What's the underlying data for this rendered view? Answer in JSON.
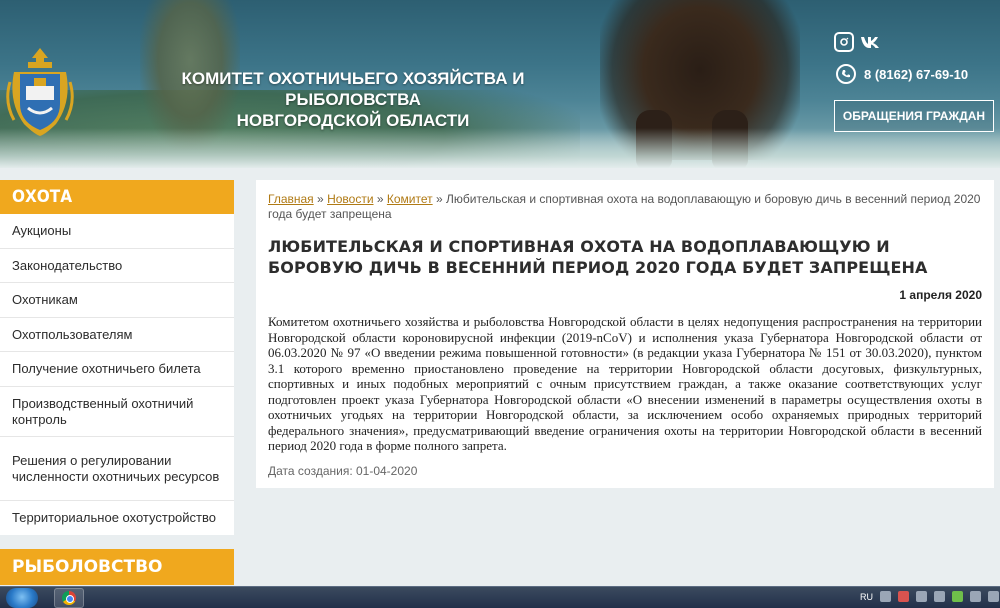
{
  "header": {
    "title_line1": "КОМИТЕТ ОХОТНИЧЬЕГО ХОЗЯЙСТВА И РЫБОЛОВСТВА",
    "title_line2": "НОВГОРОДСКОЙ ОБЛАСТИ",
    "phone": "8 (8162) 67-69-10",
    "appeal_button": "ОБРАЩЕНИЯ ГРАЖДАН",
    "social_icons": [
      "instagram-icon",
      "vk-icon"
    ]
  },
  "sidebar": {
    "section1_title": "ОХОТА",
    "items": [
      {
        "label": "Аукционы"
      },
      {
        "label": "Законодательство"
      },
      {
        "label": "Охотникам"
      },
      {
        "label": "Охотпользователям"
      },
      {
        "label": "Получение охотничьего билета"
      },
      {
        "label": "Производственный охотничий контроль"
      },
      {
        "label": "Решения о регулировании численности охотничьих ресурсов"
      },
      {
        "label": "Территориальное охотустройство"
      }
    ],
    "section2_title": "РЫБОЛОВСТВО"
  },
  "breadcrumb": {
    "home": "Главная",
    "news": "Новости",
    "committee": "Комитет",
    "current": "Любительская и спортивная охота на водоплавающую и боровую дичь в весенний период 2020 года будет запрещена",
    "separator": "»"
  },
  "article": {
    "title": "ЛЮБИТЕЛЬСКАЯ И СПОРТИВНАЯ ОХОТА НА ВОДОПЛАВАЮЩУЮ И БОРОВУЮ ДИЧЬ В ВЕСЕННИЙ ПЕРИОД 2020 ГОДА БУДЕТ ЗАПРЕЩЕНА",
    "date": "1 апреля 2020",
    "body": "Комитетом охотничьего хозяйства и рыболовства Новгородской области в целях недопущения распространения на территории Новгородской области короновирусной инфекции (2019-nCoV) и исполнения указа Губернатора Новгородской области от 06.03.2020 № 97 «О введении режима повышенной готовности» (в редакции указа Губернатора № 151 от 30.03.2020), пунктом 3.1 которого временно приостановлено проведение на территории Новгородской области досуговых, физкультурных, спортивных и иных подобных мероприятий с очным присутствием граждан, а также оказание соответствующих услуг подготовлен проект указа Губернатора Новгородской области «О внесении изменений в параметры осуществления охоты в охотничьих угодьях на территории Новгородской области, за исключением особо охраняемых природных территорий федерального значения», предусматривающий введение ограничения охоты на территории Новгородской области в весенний период 2020 года в форме полного запрета.",
    "created_label": "Дата создания: 01-04-2020"
  },
  "taskbar": {
    "language": "RU"
  }
}
